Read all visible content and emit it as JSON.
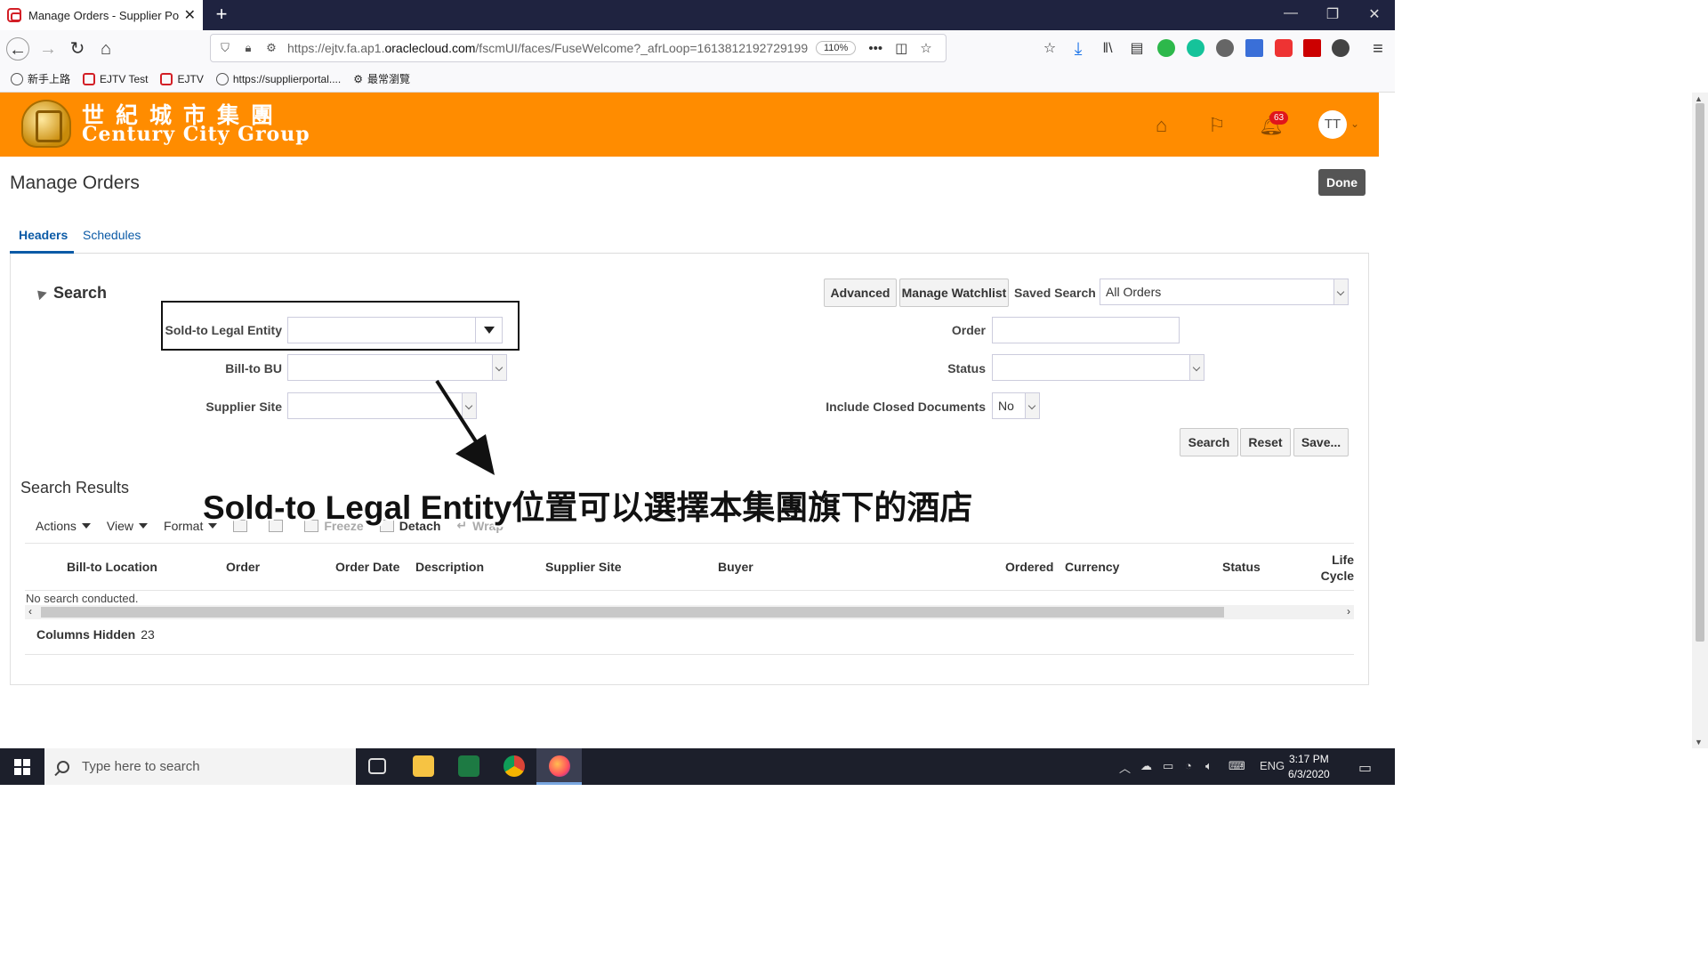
{
  "browser": {
    "tab_title": "Manage Orders - Supplier Porta",
    "url_prefix": "https://ejtv.fa.ap1.",
    "url_domain": "oraclecloud.com",
    "url_suffix": "/fscmUI/faces/FuseWelcome?_afrLoop=1613812192729199",
    "zoom": "110%",
    "bookmarks": [
      "新手上路",
      "EJTV Test",
      "EJTV",
      "https://supplierportal....",
      "最常瀏覽"
    ]
  },
  "brand": {
    "name_cn": "世紀城市集團",
    "name_en": "Century City Group",
    "notification_count": "63",
    "avatar_initials": "TT",
    "color": "#ff8c00"
  },
  "page": {
    "title": "Manage Orders",
    "done_label": "Done",
    "tabs": [
      "Headers",
      "Schedules"
    ]
  },
  "search": {
    "header": "Search",
    "fields": {
      "sold_to": {
        "label": "Sold-to Legal Entity",
        "value": ""
      },
      "bill_to_bu": {
        "label": "Bill-to BU",
        "value": ""
      },
      "supplier_site": {
        "label": "Supplier Site",
        "value": ""
      },
      "order": {
        "label": "Order",
        "value": ""
      },
      "status": {
        "label": "Status",
        "value": ""
      },
      "include_closed": {
        "label": "Include Closed Documents",
        "value": "No"
      }
    },
    "advanced_label": "Advanced",
    "manage_watchlist_label": "Manage Watchlist",
    "saved_search_label": "Saved Search",
    "saved_search_value": "All Orders",
    "search_button": "Search",
    "reset_button": "Reset",
    "save_button": "Save..."
  },
  "results": {
    "header": "Search Results",
    "toolbar": {
      "actions": "Actions",
      "view": "View",
      "format": "Format",
      "freeze": "Freeze",
      "detach": "Detach",
      "wrap": "Wrap"
    },
    "columns": [
      "Bill-to Location",
      "Order",
      "Order Date",
      "Description",
      "Supplier Site",
      "Buyer",
      "Ordered",
      "Currency",
      "Status",
      "Life Cycle"
    ],
    "empty_message": "No search conducted.",
    "columns_hidden_label": "Columns Hidden",
    "columns_hidden_count": "23"
  },
  "annotation": {
    "text": "Sold-to Legal Entity位置可以選擇本集團旗下的酒店"
  },
  "taskbar": {
    "search_placeholder": "Type here to search",
    "language": "ENG",
    "time": "3:17 PM",
    "date": "6/3/2020"
  }
}
